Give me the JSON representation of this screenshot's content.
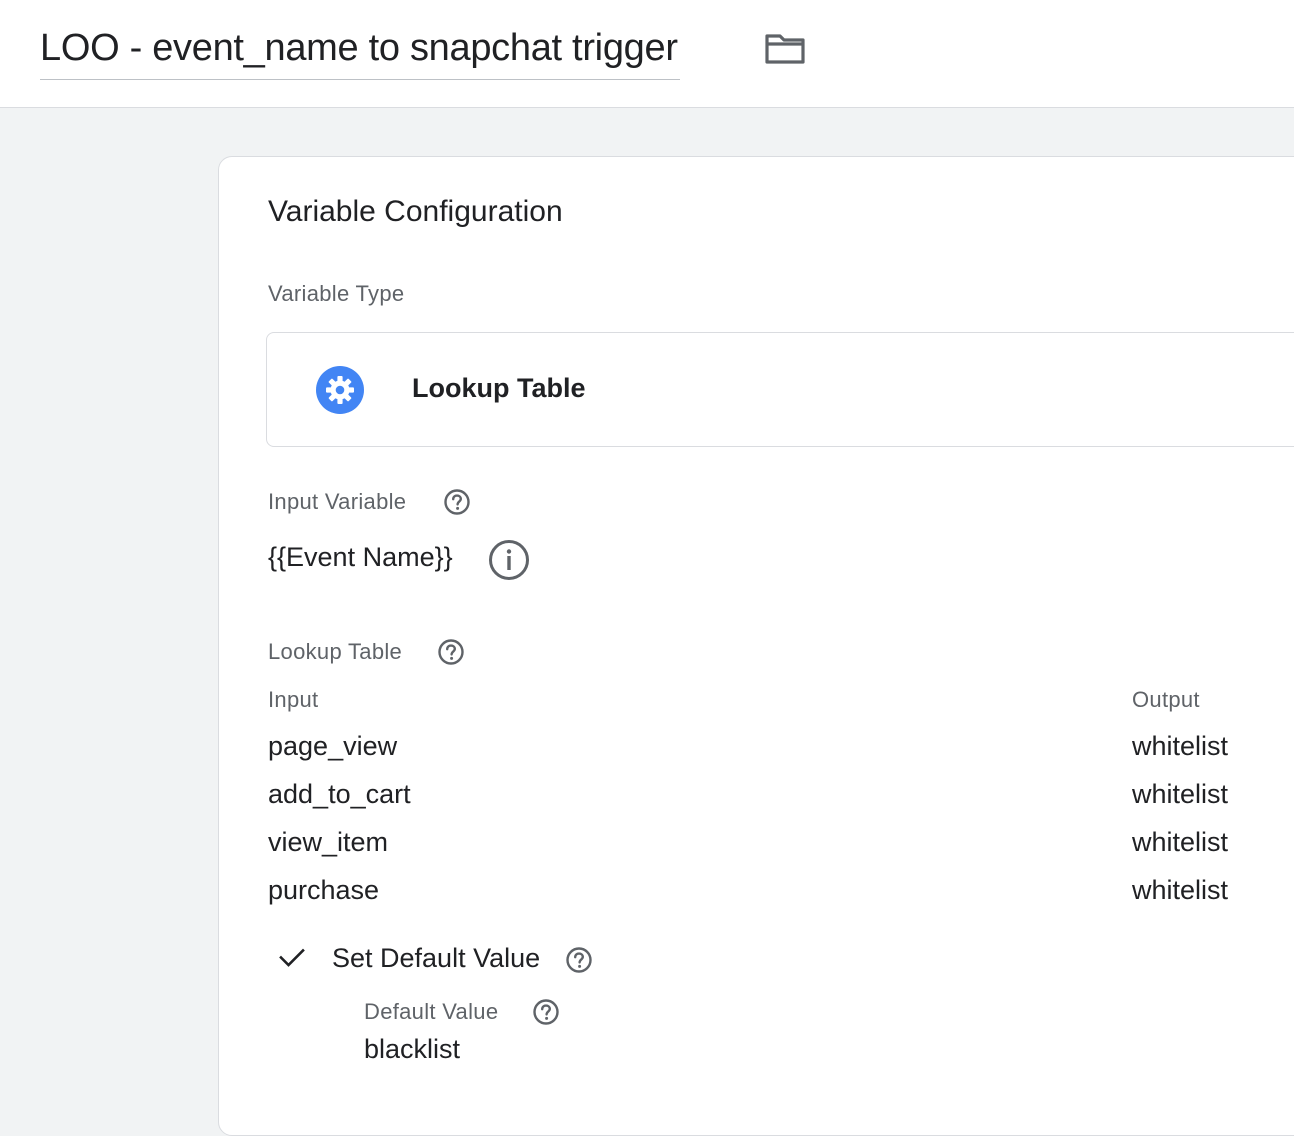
{
  "header": {
    "title": "LOO - event_name to snapchat trigger",
    "folder_icon": "folder-icon"
  },
  "config": {
    "section_title": "Variable Configuration",
    "variable_type_label": "Variable Type",
    "variable_type_name": "Lookup Table",
    "variable_type_icon": "gear-icon",
    "accent_color": "#4285f4",
    "input_variable_label": "Input Variable",
    "input_variable_value": "{{Event Name}}",
    "lookup_table_label": "Lookup Table",
    "columns": {
      "input": "Input",
      "output": "Output"
    },
    "rows": [
      {
        "input": "page_view",
        "output": "whitelist"
      },
      {
        "input": "add_to_cart",
        "output": "whitelist"
      },
      {
        "input": "view_item",
        "output": "whitelist"
      },
      {
        "input": "purchase",
        "output": "whitelist"
      }
    ],
    "set_default": {
      "label": "Set Default Value",
      "checked": true,
      "default_value_label": "Default Value",
      "default_value": "blacklist"
    }
  }
}
